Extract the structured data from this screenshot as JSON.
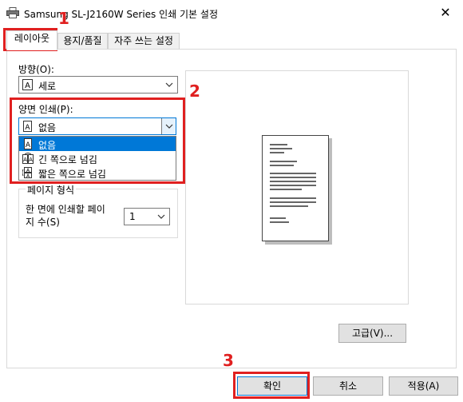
{
  "window": {
    "title": "Samsung SL-J2160W Series 인쇄 기본 설정",
    "close_glyph": "✕"
  },
  "tabs": [
    {
      "label": "레이아웃",
      "active": true
    },
    {
      "label": "용지/품질",
      "active": false
    },
    {
      "label": "자주 쓰는 설정",
      "active": false
    }
  ],
  "orientation": {
    "label": "방향(O):",
    "value": "세로"
  },
  "duplex": {
    "label": "양면 인쇄(P):",
    "value": "없음",
    "options": [
      "없음",
      "긴 쪽으로 넘김",
      "짧은 쪽으로 넘김"
    ],
    "selected_index": 0
  },
  "page_format": {
    "group_title": "페이지 형식",
    "pages_per_sheet_label_line1": "한 면에 인쇄할 페이",
    "pages_per_sheet_label_line2": "지 수(S)",
    "pages_per_sheet_value": "1"
  },
  "buttons": {
    "advanced": "고급(V)...",
    "ok": "확인",
    "cancel": "취소",
    "apply": "적용(A)"
  },
  "annotations": {
    "marker1": "1",
    "marker2": "2",
    "marker3": "3",
    "color": "#e02020"
  },
  "colors": {
    "accent": "#0078d7"
  }
}
